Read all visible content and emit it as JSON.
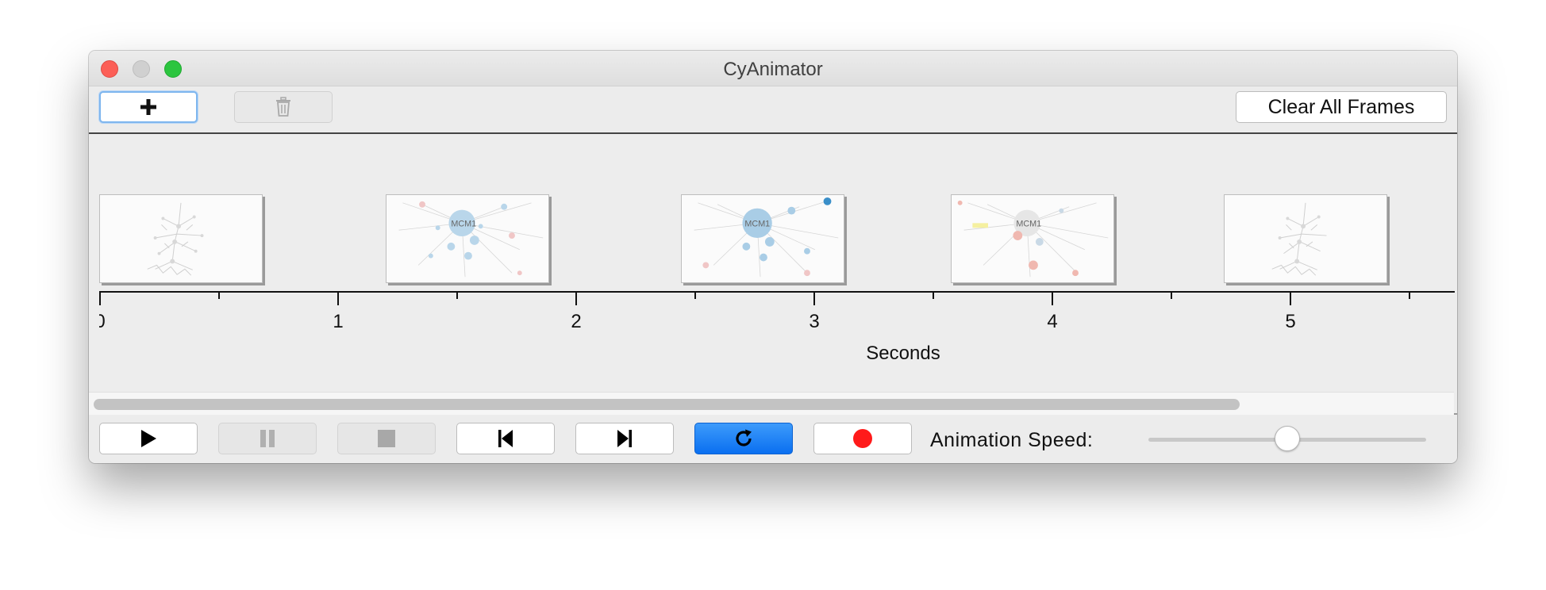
{
  "window": {
    "title": "CyAnimator"
  },
  "toolbar": {
    "add_icon": "plus-icon",
    "delete_icon": "trash-icon",
    "clear_label": "Clear All Frames"
  },
  "timeline": {
    "ticks": [
      "0",
      "1",
      "2",
      "3",
      "4",
      "5"
    ],
    "unit_label": "Seconds",
    "frames": [
      {
        "kind": "overview",
        "labels": []
      },
      {
        "kind": "detail",
        "labels": [
          "MCM1"
        ]
      },
      {
        "kind": "detail",
        "labels": [
          "MCM1"
        ]
      },
      {
        "kind": "detail",
        "labels": [
          "MCM1"
        ]
      },
      {
        "kind": "overview",
        "labels": []
      }
    ]
  },
  "controls": {
    "play_icon": "play-icon",
    "pause_icon": "pause-icon",
    "stop_icon": "stop-icon",
    "step_back_icon": "step-back-icon",
    "step_forward_icon": "step-forward-icon",
    "loop_icon": "loop-icon",
    "record_icon": "record-icon",
    "speed_label": "Animation Speed:",
    "speed_level": 0.5
  },
  "colors": {
    "primary": "#0a6ff0",
    "record": "#ff1a1a",
    "focus": "#7fb6ee"
  }
}
